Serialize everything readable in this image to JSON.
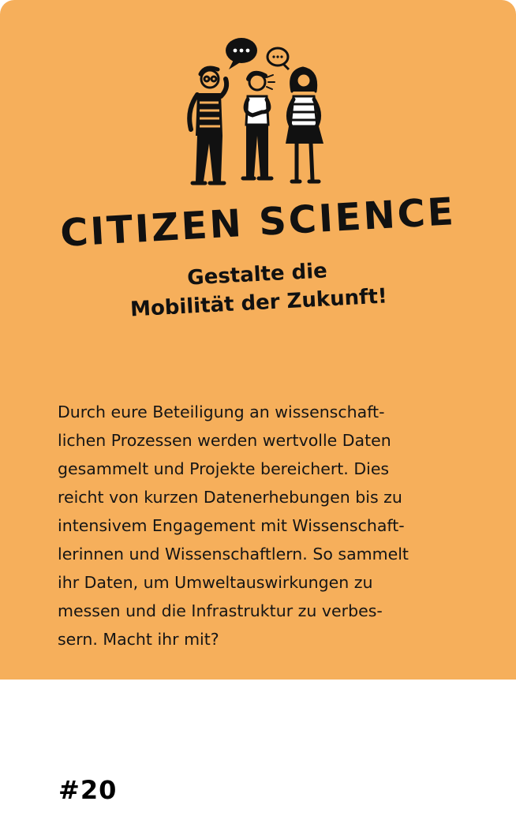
{
  "card": {
    "title": "CITIZEN SCIENCE",
    "subtitle_lines": [
      "Gestalte die",
      "Mobilität der Zukunft!"
    ],
    "illustration_icon": "three-people-talking-icon",
    "body_lines": [
      "Durch eure Beteiligung an wissenschaft-",
      "lichen Prozessen werden wertvolle Daten",
      "gesammelt und Projekte bereichert. Dies",
      "reicht von kurzen Datenerhebungen bis zu",
      "intensivem Engagement mit Wissenschaft-",
      "lerinnen und Wissenschaftlern. So sammelt",
      "ihr Daten, um Umweltauswirkungen zu",
      "messen und die Infrastruktur zu verbes-",
      "sern. Macht ihr mit?"
    ],
    "number": "#20"
  },
  "colors": {
    "card_background": "#f6af5b",
    "page_background": "#ffffff",
    "text": "#111111"
  }
}
